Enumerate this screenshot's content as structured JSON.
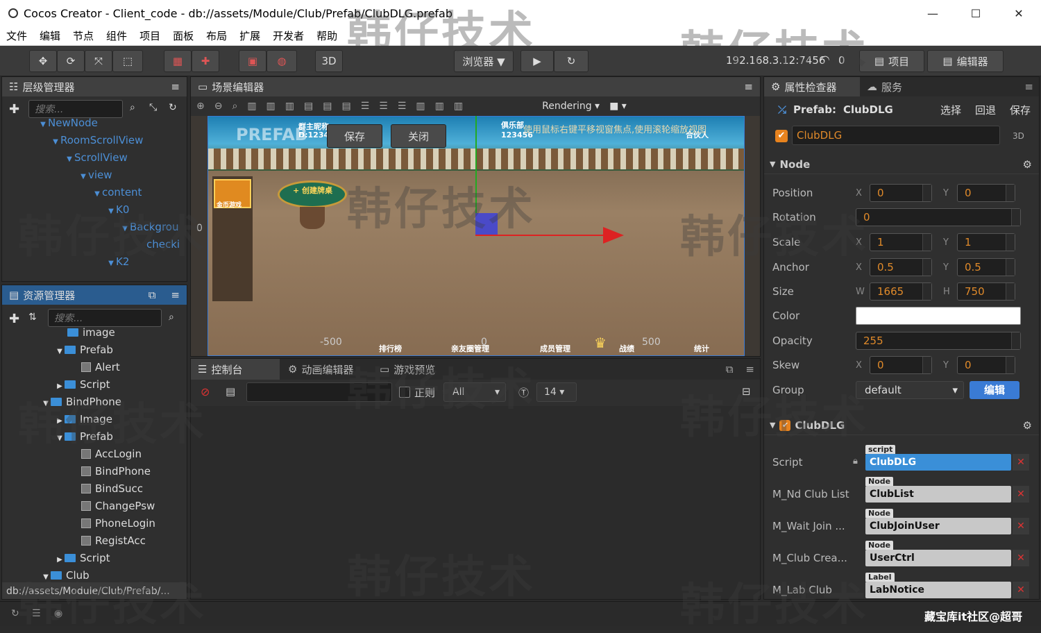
{
  "window": {
    "title": "Cocos Creator - Client_code - db://assets/Module/Club/Prefab/ClubDLG.prefab"
  },
  "menu": [
    "文件",
    "编辑",
    "节点",
    "组件",
    "项目",
    "面板",
    "布局",
    "扩展",
    "开发者",
    "帮助"
  ],
  "toolbar": {
    "mode3d": "3D",
    "browser": "浏览器 ▼",
    "ip": "192.168.3.12:7456",
    "wifi_count": "0",
    "project": "项目",
    "editor": "编辑器"
  },
  "hierarchy": {
    "title": "层级管理器",
    "search": "搜索...",
    "items": [
      "NewNode",
      "RoomScrollView",
      "ScrollView",
      "view",
      "content",
      "K0",
      "Backgrou",
      "checki",
      "K2"
    ]
  },
  "assets": {
    "title": "资源管理器",
    "search": "搜索...",
    "items": [
      "image",
      "Prefab",
      "Alert",
      "Script",
      "BindPhone",
      "Image",
      "Prefab",
      "AccLogin",
      "BindPhone",
      "BindSucc",
      "ChangePsw",
      "PhoneLogin",
      "RegistAcc",
      "Script",
      "Club"
    ],
    "path": "db://assets/Module/Club/Prefab/..."
  },
  "scene": {
    "title": "场景编辑器",
    "rendering": "Rendering",
    "prefab_label": "PREFAB",
    "save": "保存",
    "close": "关闭",
    "hint": "使用鼠标右键平移视窗焦点,使用滚轮缩放视图",
    "axis_left": "-500",
    "axis_zero": "0",
    "axis_right": "500",
    "axis_y0": "0",
    "hud": {
      "group_owner": "群主昵称",
      "group_id": "D:12345",
      "club": "俱乐部",
      "club_id": "123456",
      "partner": "合伙人",
      "create_table": "+ 创建牌桌",
      "rank": "排行榜",
      "friend_mgr": "亲友圈管理",
      "member_mgr": "成员管理",
      "battle": "战绩",
      "stats": "统计",
      "table_name": "金币游戏"
    }
  },
  "console": {
    "tabs": [
      "控制台",
      "动画编辑器",
      "游戏预览"
    ],
    "regex": "正则",
    "filter": "All",
    "fontsize": "14"
  },
  "inspector": {
    "tabs": [
      "属性检查器",
      "服务"
    ],
    "prefab_label": "Prefab:",
    "prefab_name": "ClubDLG",
    "select": "选择",
    "revert": "回退",
    "save": "保存",
    "node_name": "ClubDLG",
    "mode": "3D",
    "node_section": "Node",
    "position": {
      "label": "Position",
      "x": "0",
      "y": "0"
    },
    "rotation": {
      "label": "Rotation",
      "v": "0"
    },
    "scale": {
      "label": "Scale",
      "x": "1",
      "y": "1"
    },
    "anchor": {
      "label": "Anchor",
      "x": "0.5",
      "y": "0.5"
    },
    "size": {
      "label": "Size",
      "w": "1665",
      "h": "750"
    },
    "color": {
      "label": "Color",
      "value": "#ffffff"
    },
    "opacity": {
      "label": "Opacity",
      "v": "255"
    },
    "skew": {
      "label": "Skew",
      "x": "0",
      "y": "0"
    },
    "group": {
      "label": "Group",
      "v": "default",
      "edit": "编辑"
    },
    "component": "ClubDLG",
    "fields": [
      {
        "label": "Script",
        "tag": "script",
        "value": "ClubDLG"
      },
      {
        "label": "M_Nd Club List",
        "tag": "Node",
        "value": "ClubList"
      },
      {
        "label": "M_Wait Join ...",
        "tag": "Node",
        "value": "ClubJoinUser"
      },
      {
        "label": "M_Club Crea...",
        "tag": "Node",
        "value": "UserCtrl"
      },
      {
        "label": "M_Lab Club",
        "tag": "Label",
        "value": "LabNotice"
      }
    ]
  },
  "footer": {
    "credit": "藏宝库it社区@超哥"
  },
  "watermark": "韩仔技术"
}
